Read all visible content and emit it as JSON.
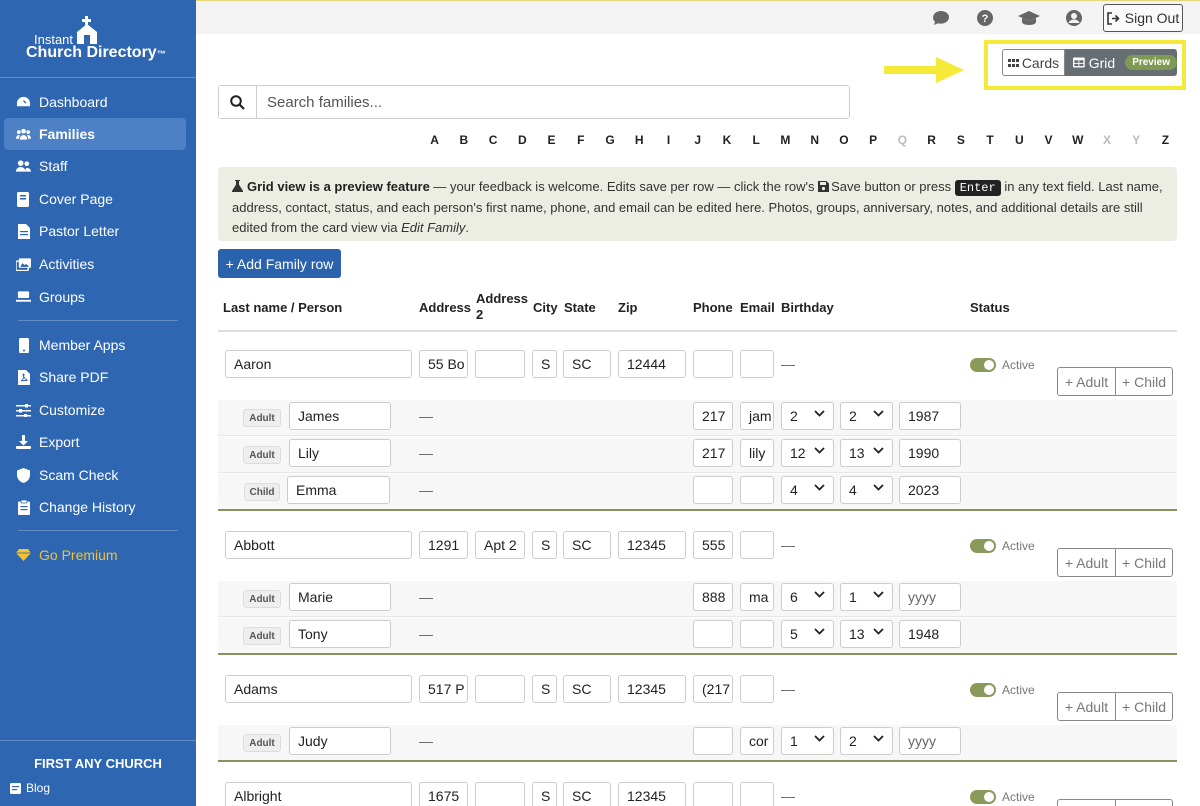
{
  "brand": {
    "line1": "Instant",
    "line2": "Church Directory",
    "tm": "™"
  },
  "sidebar": {
    "items": [
      {
        "label": "Dashboard",
        "icon": "dashboard-icon"
      },
      {
        "label": "Families",
        "icon": "users-icon",
        "active": true
      },
      {
        "label": "Staff",
        "icon": "staff-icon"
      },
      {
        "label": "Cover Page",
        "icon": "book-icon"
      },
      {
        "label": "Pastor Letter",
        "icon": "letter-icon"
      },
      {
        "label": "Activities",
        "icon": "images-icon"
      },
      {
        "label": "Groups",
        "icon": "groups-icon"
      },
      {
        "label": "Member Apps",
        "icon": "mobile-icon"
      },
      {
        "label": "Share PDF",
        "icon": "pdf-icon"
      },
      {
        "label": "Customize",
        "icon": "sliders-icon"
      },
      {
        "label": "Export",
        "icon": "download-icon"
      },
      {
        "label": "Scam Check",
        "icon": "shield-icon"
      },
      {
        "label": "Change History",
        "icon": "history-icon"
      },
      {
        "label": "Go Premium",
        "icon": "gem-icon"
      }
    ],
    "church_name": "FIRST ANY CHURCH",
    "blog": "Blog"
  },
  "topbar": {
    "sign_out": "Sign Out"
  },
  "view_toggle": {
    "cards": "Cards",
    "grid": "Grid",
    "preview": "Preview"
  },
  "search": {
    "placeholder": "Search families..."
  },
  "alphabet": [
    "A",
    "B",
    "C",
    "D",
    "E",
    "F",
    "G",
    "H",
    "I",
    "J",
    "K",
    "L",
    "M",
    "N",
    "O",
    "P",
    "Q",
    "R",
    "S",
    "T",
    "U",
    "V",
    "W",
    "X",
    "Y",
    "Z"
  ],
  "alphabet_disabled": [
    "Q",
    "X",
    "Y"
  ],
  "banner": {
    "title": "Grid view is a preview feature",
    "text1": " — your feedback is welcome. Edits save per row — click the row's ",
    "save": "Save",
    "text2": " button or press ",
    "key": "Enter",
    "text3": " in any text field. Last name, address, contact, status, and each person's first name, phone, and email can be edited here. Photos, groups, anniversary, notes, and additional details are still edited from the card view via ",
    "link": "Edit Family",
    "end": "."
  },
  "add_family_label": "+ Add Family row",
  "columns": {
    "last_name": "Last name / Person",
    "address": "Address",
    "address2": "Address 2",
    "city": "City",
    "state": "State",
    "zip": "Zip",
    "phone": "Phone",
    "email": "Email",
    "birthday": "Birthday",
    "status": "Status"
  },
  "row_text": {
    "dash": "—",
    "active": "Active",
    "add_adult": "+ Adult",
    "add_child": "+ Child",
    "yyyy": "yyyy"
  },
  "families": [
    {
      "last": "Aaron",
      "address": "55 Bo",
      "address2": "",
      "city": "S",
      "state": "SC",
      "zip": "12444",
      "phone": "",
      "email": "",
      "people": [
        {
          "role": "Adult",
          "first": "James",
          "phone": "217",
          "email": "jam",
          "month": "2",
          "day": "2",
          "year": "1987"
        },
        {
          "role": "Adult",
          "first": "Lily",
          "phone": "217",
          "email": "lily",
          "month": "12",
          "day": "13",
          "year": "1990"
        },
        {
          "role": "Child",
          "first": "Emma",
          "phone": "",
          "email": "",
          "month": "4",
          "day": "4",
          "year": "2023"
        }
      ]
    },
    {
      "last": "Abbott",
      "address": "1291",
      "address2": "Apt 2",
      "city": "S",
      "state": "SC",
      "zip": "12345",
      "phone": "555",
      "email": "",
      "people": [
        {
          "role": "Adult",
          "first": "Marie",
          "phone": "888",
          "email": "ma",
          "month": "6",
          "day": "1",
          "year": ""
        },
        {
          "role": "Adult",
          "first": "Tony",
          "phone": "",
          "email": "",
          "month": "5",
          "day": "13",
          "year": "1948"
        }
      ]
    },
    {
      "last": "Adams",
      "address": "517 P",
      "address2": "",
      "city": "S",
      "state": "SC",
      "zip": "12345",
      "phone": "(217",
      "email": "",
      "people": [
        {
          "role": "Adult",
          "first": "Judy",
          "phone": "",
          "email": "cor",
          "month": "1",
          "day": "2",
          "year": ""
        }
      ]
    },
    {
      "last": "Albright",
      "address": "1675",
      "address2": "",
      "city": "S",
      "state": "SC",
      "zip": "12345",
      "phone": "",
      "email": "",
      "people": []
    }
  ]
}
